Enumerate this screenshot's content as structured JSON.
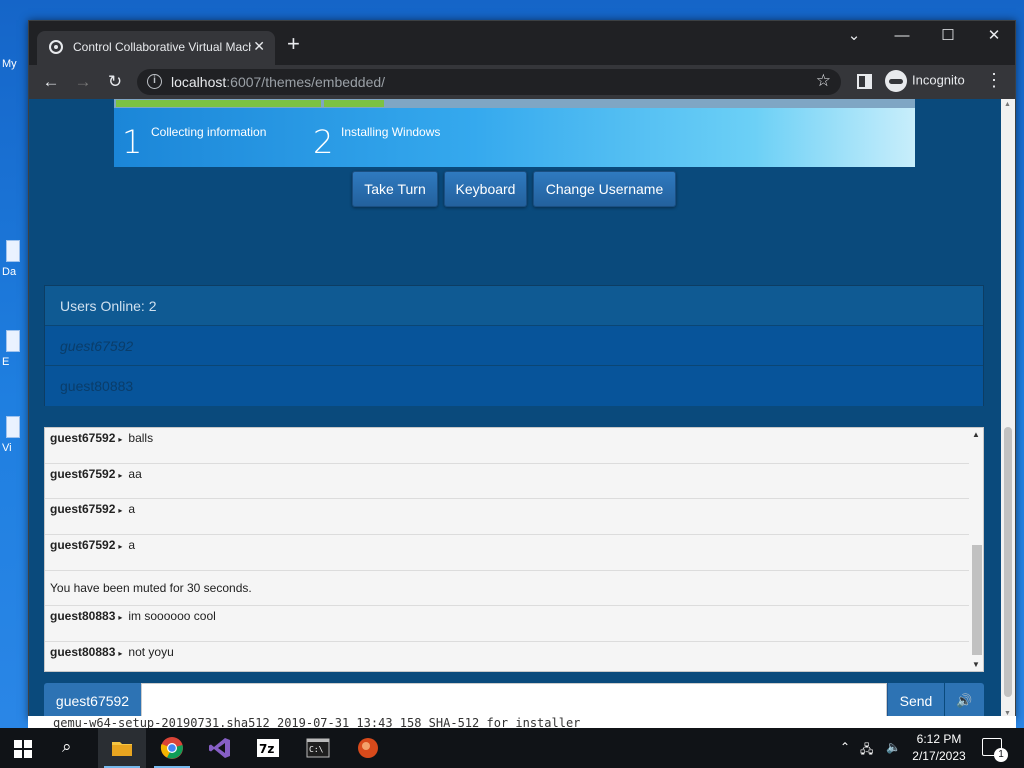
{
  "desktop": {
    "icons": [
      {
        "label": "My"
      },
      {
        "label": "Da"
      },
      {
        "label": "E"
      },
      {
        "label": "Vi"
      }
    ]
  },
  "browser": {
    "tab_title": "Control Collaborative Virtual Machine",
    "url_host": "localhost",
    "url_rest": ":6007/themes/embedded/",
    "profile_label": "Incognito"
  },
  "vm": {
    "steps": [
      {
        "number": "1",
        "label": "Collecting information"
      },
      {
        "number": "2",
        "label": "Installing Windows"
      }
    ],
    "buttons": {
      "take_turn": "Take Turn",
      "keyboard": "Keyboard",
      "change_username": "Change Username"
    }
  },
  "users": {
    "header": "Users Online: 2",
    "list": [
      "guest67592",
      "guest80883"
    ]
  },
  "chat": {
    "messages": [
      {
        "user": "guest67592",
        "text": "balls"
      },
      {
        "user": "guest67592",
        "text": "aa"
      },
      {
        "user": "guest67592",
        "text": "a"
      },
      {
        "user": "guest67592",
        "text": "a"
      },
      {
        "user": "",
        "text": "You have been muted for 30 seconds."
      },
      {
        "user": "guest80883",
        "text": "im soooooo cool"
      },
      {
        "user": "guest80883",
        "text": "not yoyu"
      }
    ],
    "username_button": "guest67592",
    "input_value": "",
    "send_label": "Send"
  },
  "background_window": {
    "line1": "qemu-w64-setup-20190731.sha512 2019-07-31 13:43  158   SHA-512 for installer"
  },
  "taskbar": {
    "time": "6:12 PM",
    "date": "2/17/2023",
    "notification_count": "1"
  }
}
